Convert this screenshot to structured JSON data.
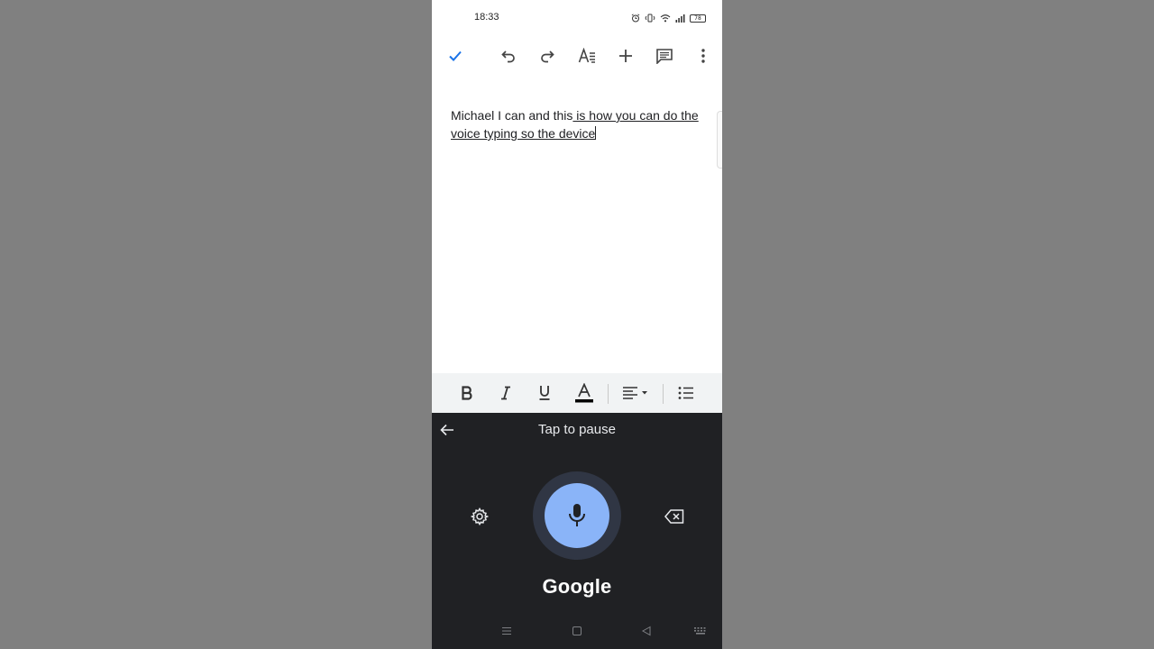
{
  "status_bar": {
    "time": "18:33",
    "battery": "78"
  },
  "toolbar": {
    "icons": [
      "check-icon",
      "undo-icon",
      "redo-icon",
      "text-format-icon",
      "add-icon",
      "comment-icon",
      "more-vert-icon"
    ],
    "accent_color": "#1a73e8"
  },
  "document": {
    "plain_text": "Michael I can and this",
    "typed_text": " is how you can do the voice typing so the device"
  },
  "format_bar": {
    "icons": [
      "bold-icon",
      "italic-icon",
      "underline-icon",
      "text-color-icon",
      "align-icon",
      "bulleted-list-icon"
    ]
  },
  "voice_typing": {
    "status": "Tap to pause",
    "brand": "Google",
    "mic_color": "#8ab4f8",
    "panel_color": "#202124"
  },
  "nav_bar": {
    "icons": [
      "menu-icon",
      "home-icon",
      "back-icon",
      "keyboard-icon"
    ]
  }
}
